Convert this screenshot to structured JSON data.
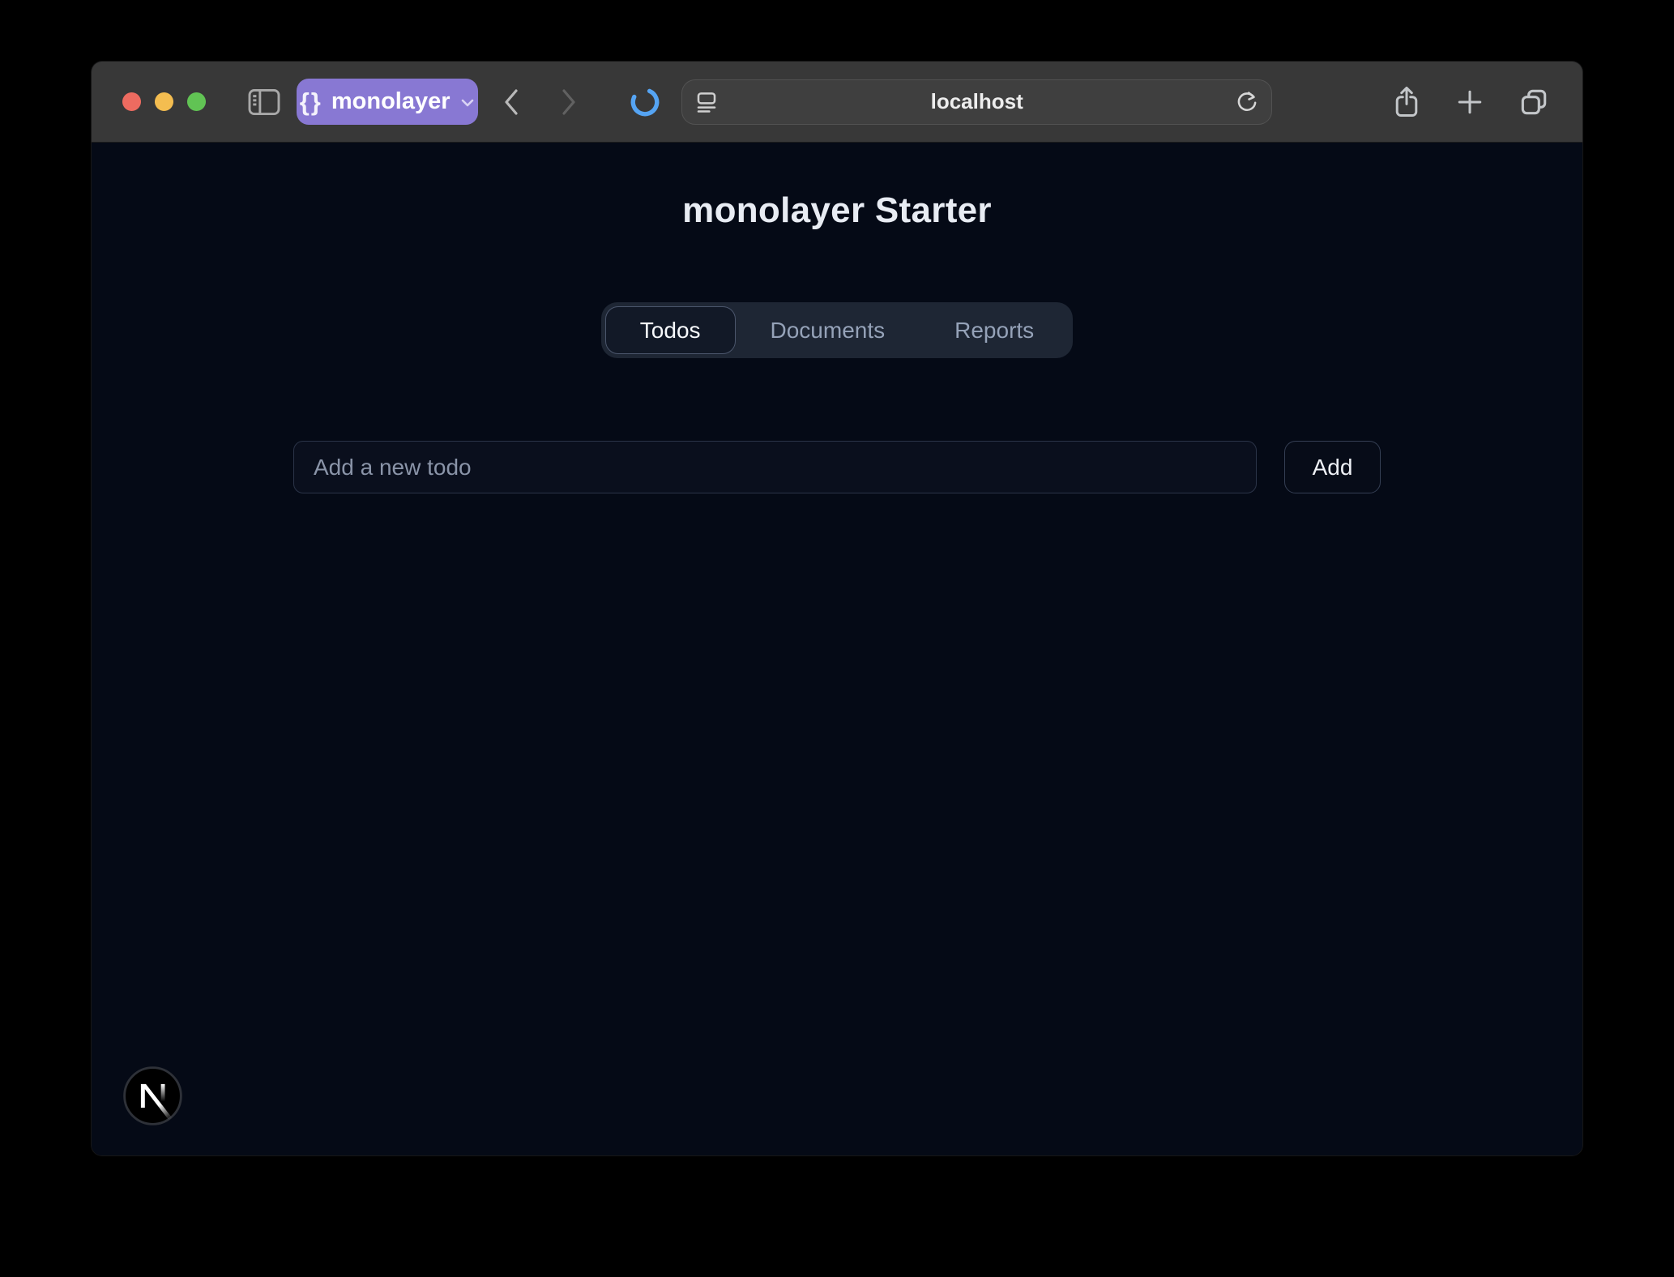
{
  "browser": {
    "traffic_lights": {
      "close": "close",
      "minimize": "minimize",
      "zoom": "zoom"
    },
    "profile_badge": {
      "icon_glyph": "{}",
      "label": "monolayer"
    },
    "address_bar": {
      "url": "localhost"
    },
    "icons": {
      "sidebar": "sidebar-toggle-icon",
      "back": "chevron-left-icon",
      "forward": "chevron-right-icon",
      "loading": "progress-spinner",
      "page_settings": "page-format-icon",
      "reload": "reload-icon",
      "share": "share-icon",
      "new_tab": "plus-icon",
      "tab_overview": "tab-overview-icon"
    }
  },
  "page": {
    "title": "monolayer Starter",
    "tab_bar": {
      "tabs": [
        {
          "label": "Todos",
          "active": true
        },
        {
          "label": "Documents",
          "active": false
        },
        {
          "label": "Reports",
          "active": false
        }
      ]
    },
    "todo_form": {
      "input_placeholder": "Add a new todo",
      "input_value": "",
      "add_button_label": "Add"
    },
    "footer_logo": "nextjs-logo"
  },
  "colors": {
    "badge_purple": "#8878d3",
    "spinner_blue": "#55a4f3",
    "toolbar_bg": "#383838",
    "page_bg": "#050a16",
    "traffic_red": "#ed6b60",
    "traffic_yellow": "#f4bd50",
    "traffic_green": "#61c354"
  }
}
